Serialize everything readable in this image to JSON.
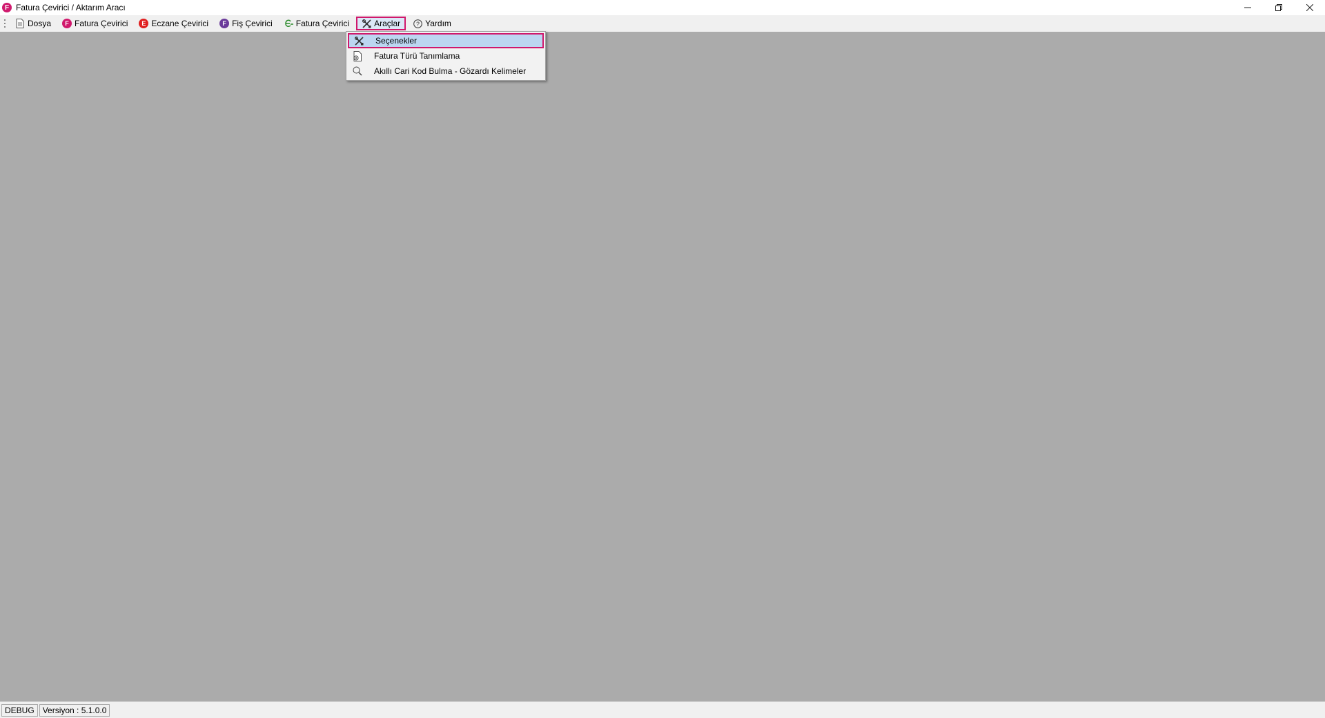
{
  "window": {
    "title": "Fatura Çevirici / Aktarım Aracı",
    "app_icon_letter": "F",
    "accent_color": "#d0186c"
  },
  "menubar": {
    "items": [
      {
        "label": "Dosya",
        "icon": "document-icon"
      },
      {
        "label": "Fatura Çevirici",
        "icon": "fatura-f-icon",
        "letter": "F",
        "color": "#d0186c"
      },
      {
        "label": "Eczane Çevirici",
        "icon": "eczane-e-icon",
        "letter": "E",
        "color": "#e02020"
      },
      {
        "label": "Fiş Çevirici",
        "icon": "fis-f-icon",
        "letter": "F",
        "color": "#6a3a9a"
      },
      {
        "label": "Fatura Çevirici",
        "icon": "e-fatura-icon",
        "color": "#2a8a2a"
      },
      {
        "label": "Araçlar",
        "icon": "tools-icon"
      },
      {
        "label": "Yardım",
        "icon": "help-icon"
      }
    ]
  },
  "dropdown": {
    "items": [
      {
        "label": "Seçenekler",
        "icon": "tools-icon"
      },
      {
        "label": "Fatura Türü Tanımlama",
        "icon": "document-gear-icon"
      },
      {
        "label": "Akıllı Cari Kod Bulma - Gözardı Kelimeler",
        "icon": "search-icon"
      }
    ]
  },
  "statusbar": {
    "mode": "DEBUG",
    "version": "Versiyon : 5.1.0.0"
  }
}
